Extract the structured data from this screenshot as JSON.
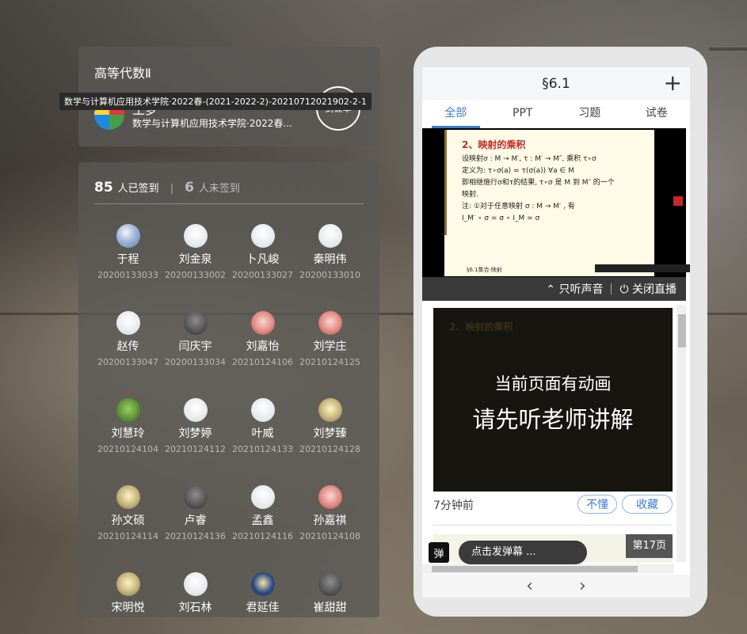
{
  "course": {
    "title": "高等代数Ⅱ",
    "tooltip": "数学与计算机应用技术学院·2022春-(2021-2022-2)-20210712021902-2-1",
    "teacher_partial": "王梦",
    "class_name": "数学与计算机应用技术学院·2022春...",
    "rate_label": "到课率"
  },
  "roster": {
    "signed_count": "85",
    "signed_label": "人已签到",
    "separator": "|",
    "unsigned_count": "6",
    "unsigned_label": "人未签到",
    "students": [
      {
        "name": "于程",
        "id": "20200133033",
        "avatar": "rocket"
      },
      {
        "name": "刘金泉",
        "id": "20200133002",
        "avatar": "default"
      },
      {
        "name": "卜凡峻",
        "id": "20200133027",
        "avatar": "default"
      },
      {
        "name": "秦明伟",
        "id": "20200133010",
        "avatar": "default"
      },
      {
        "name": "赵传",
        "id": "20200133047",
        "avatar": "default"
      },
      {
        "name": "闫庆宇",
        "id": "20200133034",
        "avatar": "photo"
      },
      {
        "name": "刘嘉怡",
        "id": "20210124106",
        "avatar": "anime"
      },
      {
        "name": "刘学庄",
        "id": "20210124125",
        "avatar": "anime"
      },
      {
        "name": "刘慧玲",
        "id": "20210124104",
        "avatar": "frog"
      },
      {
        "name": "刘梦婷",
        "id": "20210124112",
        "avatar": "default"
      },
      {
        "name": "叶威",
        "id": "20210124133",
        "avatar": "default"
      },
      {
        "name": "刘梦臻",
        "id": "20210124128",
        "avatar": "cartoon"
      },
      {
        "name": "孙文硕",
        "id": "20210124114",
        "avatar": "cartoon"
      },
      {
        "name": "卢睿",
        "id": "20210124136",
        "avatar": "photo"
      },
      {
        "name": "孟鑫",
        "id": "20210124116",
        "avatar": "default"
      },
      {
        "name": "孙嘉祺",
        "id": "20210124108",
        "avatar": "anime"
      },
      {
        "name": "宋明悦",
        "id": "",
        "avatar": "cartoon"
      },
      {
        "name": "刘石林",
        "id": "",
        "avatar": "default"
      },
      {
        "name": "君延佳",
        "id": "",
        "avatar": "badge"
      },
      {
        "name": "崔甜甜",
        "id": "",
        "avatar": "photo"
      }
    ]
  },
  "phone": {
    "title": "§6.1",
    "tabs": [
      "全部",
      "PPT",
      "习题",
      "试卷"
    ],
    "active_tab": 0,
    "slide": {
      "heading": "2、映射的乘积",
      "lines": [
        "设映射σ : M → M′, τ : M′ → M″, 乘积 τ∘σ",
        "定义为: τ∘σ(a) = τ(σ(a))  ∀a ∈ M",
        "即相继施行σ和τ的结果, τ∘σ 是 M 到 M″ 的一个",
        "映射.",
        "注: ①对于任意映射 σ : M → M′ , 有",
        "I_M′ ∘ σ = σ ∘ I_M = σ"
      ],
      "footer": "§6.1集合·映射"
    },
    "live_controls": {
      "audio_only": "只听声音",
      "close_live": "关闭直播"
    },
    "animation_notice": {
      "line1": "当前页面有动画",
      "line2": "请先听老师讲解"
    },
    "time_ago": "7分钟前",
    "buttons": {
      "dont_understand": "不懂",
      "favorite": "收藏"
    },
    "page_badge": "第17页",
    "danmu_label": "弹",
    "danmu_placeholder": "点击发弹幕 ..."
  }
}
